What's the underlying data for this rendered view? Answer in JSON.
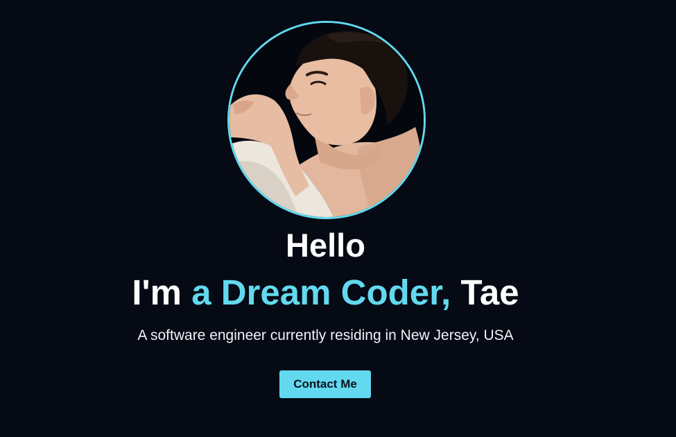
{
  "hero": {
    "avatar_alt": "Portrait photo of Tae",
    "greeting": "Hello",
    "intro_prefix": "I'm ",
    "intro_accent": "a Dream Coder,",
    "intro_suffix": " Tae",
    "tagline": "A software engineer currently residing in New Jersey, USA",
    "contact_label": "Contact Me"
  },
  "colors": {
    "background": "#050a14",
    "accent": "#62d9ef",
    "text": "#ffffff",
    "button_text": "#08111d"
  }
}
